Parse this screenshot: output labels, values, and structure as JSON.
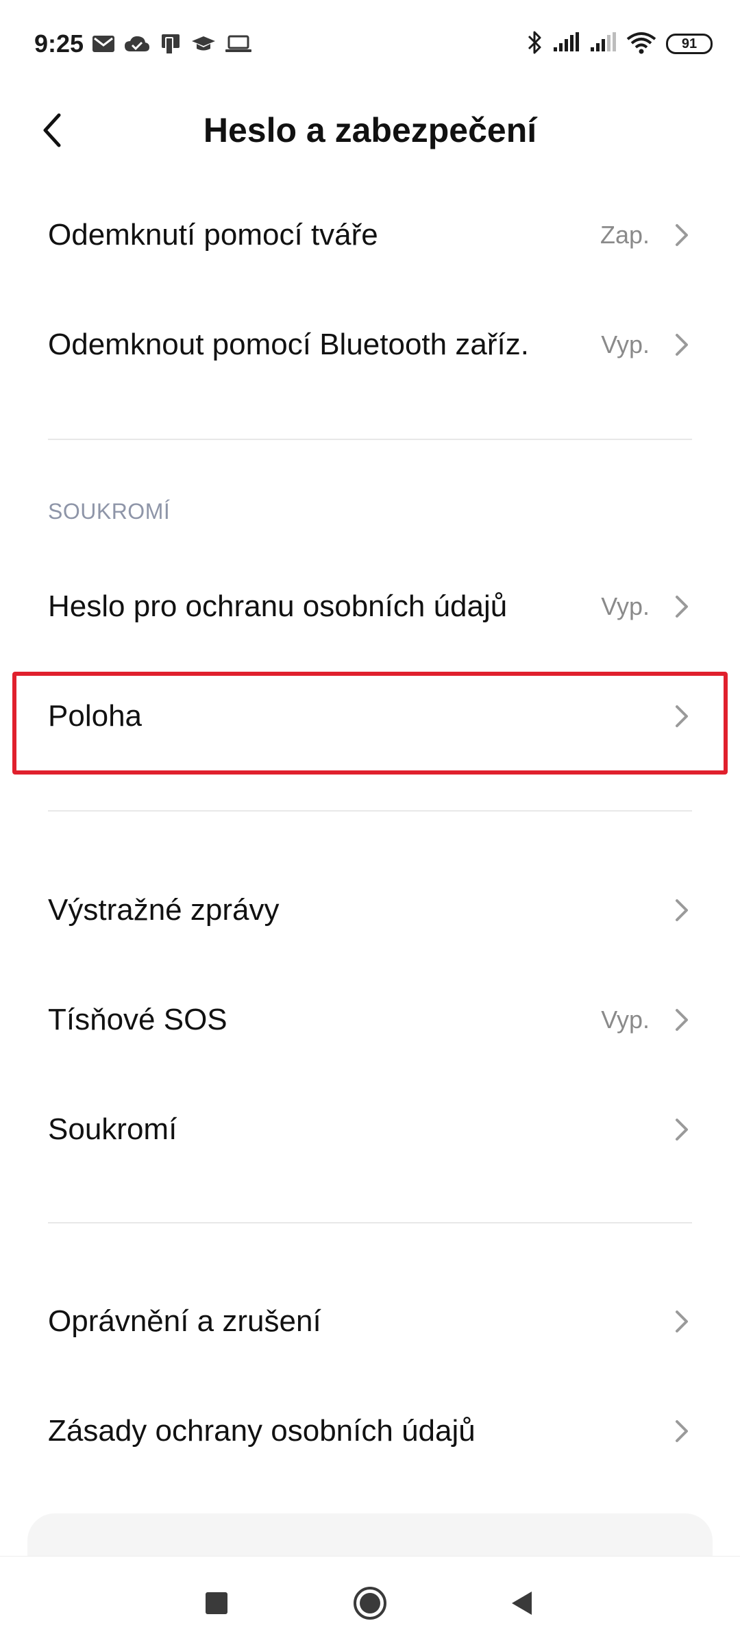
{
  "status_bar": {
    "time": "9:25",
    "battery": "91",
    "notification_icons": [
      "gmail-icon",
      "cloud-check-icon",
      "device-icon",
      "graduation-cap-icon",
      "laptop-icon"
    ],
    "system_icons": [
      "bluetooth-icon",
      "signal-icon",
      "signal-icon",
      "wifi-icon",
      "battery-icon"
    ]
  },
  "header": {
    "title": "Heslo a zabezpečení",
    "back_icon": "chevron-left-icon"
  },
  "sections": {
    "privacy_header": "SOUKROMÍ"
  },
  "items": [
    {
      "label": "Odemknutí pomocí tváře",
      "value": "Zap."
    },
    {
      "label": "Odemknout pomocí Bluetooth zaříz.",
      "value": "Vyp."
    },
    {
      "label": "Heslo pro ochranu osobních údajů",
      "value": "Vyp."
    },
    {
      "label": "Poloha",
      "value": ""
    },
    {
      "label": "Výstražné zprávy",
      "value": ""
    },
    {
      "label": "Tísňové SOS",
      "value": "Vyp."
    },
    {
      "label": "Soukromí",
      "value": ""
    },
    {
      "label": "Oprávnění a zrušení",
      "value": ""
    },
    {
      "label": "Zásady ochrany osobních údajů",
      "value": ""
    }
  ],
  "colors": {
    "highlight": "#e0202d",
    "section_header": "#8e95a8",
    "value_text": "#8a8a8a"
  },
  "nav_bar": {
    "buttons": [
      "recents-square-icon",
      "home-circle-icon",
      "back-triangle-icon"
    ]
  }
}
